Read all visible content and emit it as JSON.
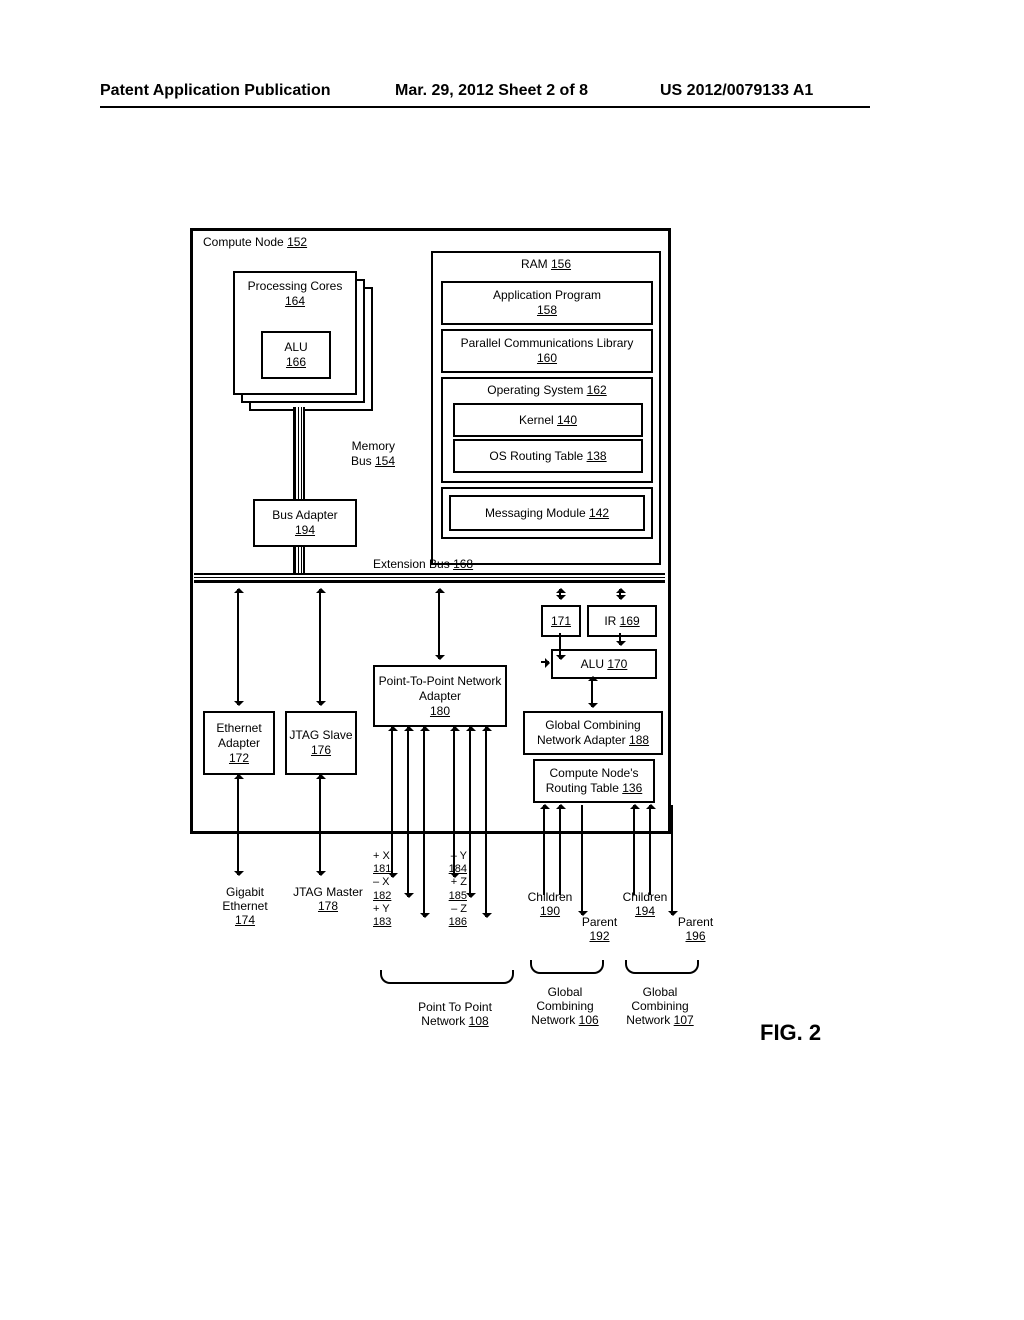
{
  "header": {
    "left": "Patent Application Publication",
    "center": "Mar. 29, 2012  Sheet 2 of 8",
    "right": "US 2012/0079133 A1"
  },
  "figure_label": "FIG. 2",
  "compute_node": {
    "title": "Compute Node",
    "ref": "152",
    "processing_cores": {
      "title": "Processing Cores",
      "ref": "164"
    },
    "alu": {
      "title": "ALU",
      "ref": "166"
    },
    "memory_bus": {
      "title": "Memory Bus",
      "ref": "154"
    },
    "bus_adapter": {
      "title": "Bus Adapter",
      "ref": "194"
    },
    "extension_bus": {
      "title": "Extension Bus",
      "ref": "168"
    },
    "ram": {
      "title": "RAM",
      "ref": "156",
      "application_program": {
        "title": "Application Program",
        "ref": "158"
      },
      "parallel_comm_lib": {
        "title": "Parallel Communications Library",
        "ref": "160"
      },
      "operating_system": {
        "title": "Operating System",
        "ref": "162",
        "kernel": {
          "title": "Kernel",
          "ref": "140"
        },
        "os_routing_table": {
          "title": "OS Routing Table",
          "ref": "138"
        }
      },
      "messaging_module": {
        "title": "Messaging Module",
        "ref": "142"
      }
    },
    "blank171_ref": "171",
    "ir": {
      "title": "IR",
      "ref": "169"
    },
    "alu170": {
      "title": "ALU",
      "ref": "170"
    },
    "ethernet_adapter": {
      "title": "Ethernet Adapter",
      "ref": "172"
    },
    "jtag_slave": {
      "title": "JTAG Slave",
      "ref": "176"
    },
    "p2p_adapter": {
      "title": "Point-To-Point Network Adapter",
      "ref": "180"
    },
    "global_combining_adapter": {
      "title": "Global Combining Network Adapter",
      "ref": "188"
    },
    "node_routing_table": {
      "title": "Compute Node's Routing Table",
      "ref": "136"
    }
  },
  "external": {
    "gigabit_ethernet": {
      "title": "Gigabit Ethernet",
      "ref": "174"
    },
    "jtag_master": {
      "title": "JTAG Master",
      "ref": "178"
    },
    "dirs": {
      "px": {
        "label": "+ X",
        "ref": "181"
      },
      "nx": {
        "label": "– X",
        "ref": "182"
      },
      "py": {
        "label": "+ Y",
        "ref": "183"
      },
      "ny": {
        "label": "– Y",
        "ref": "184"
      },
      "pz": {
        "label": "+ Z",
        "ref": "185"
      },
      "nz": {
        "label": "– Z",
        "ref": "186"
      }
    },
    "p2p_network": {
      "title": "Point To Point Network",
      "ref": "108"
    },
    "children1": {
      "title": "Children",
      "ref": "190"
    },
    "parent1": {
      "title": "Parent",
      "ref": "192"
    },
    "children2": {
      "title": "Children",
      "ref": "194"
    },
    "parent2": {
      "title": "Parent",
      "ref": "196"
    },
    "gcn1": {
      "title": "Global Combining Network",
      "ref": "106"
    },
    "gcn2": {
      "title": "Global Combining Network",
      "ref": "107"
    }
  }
}
